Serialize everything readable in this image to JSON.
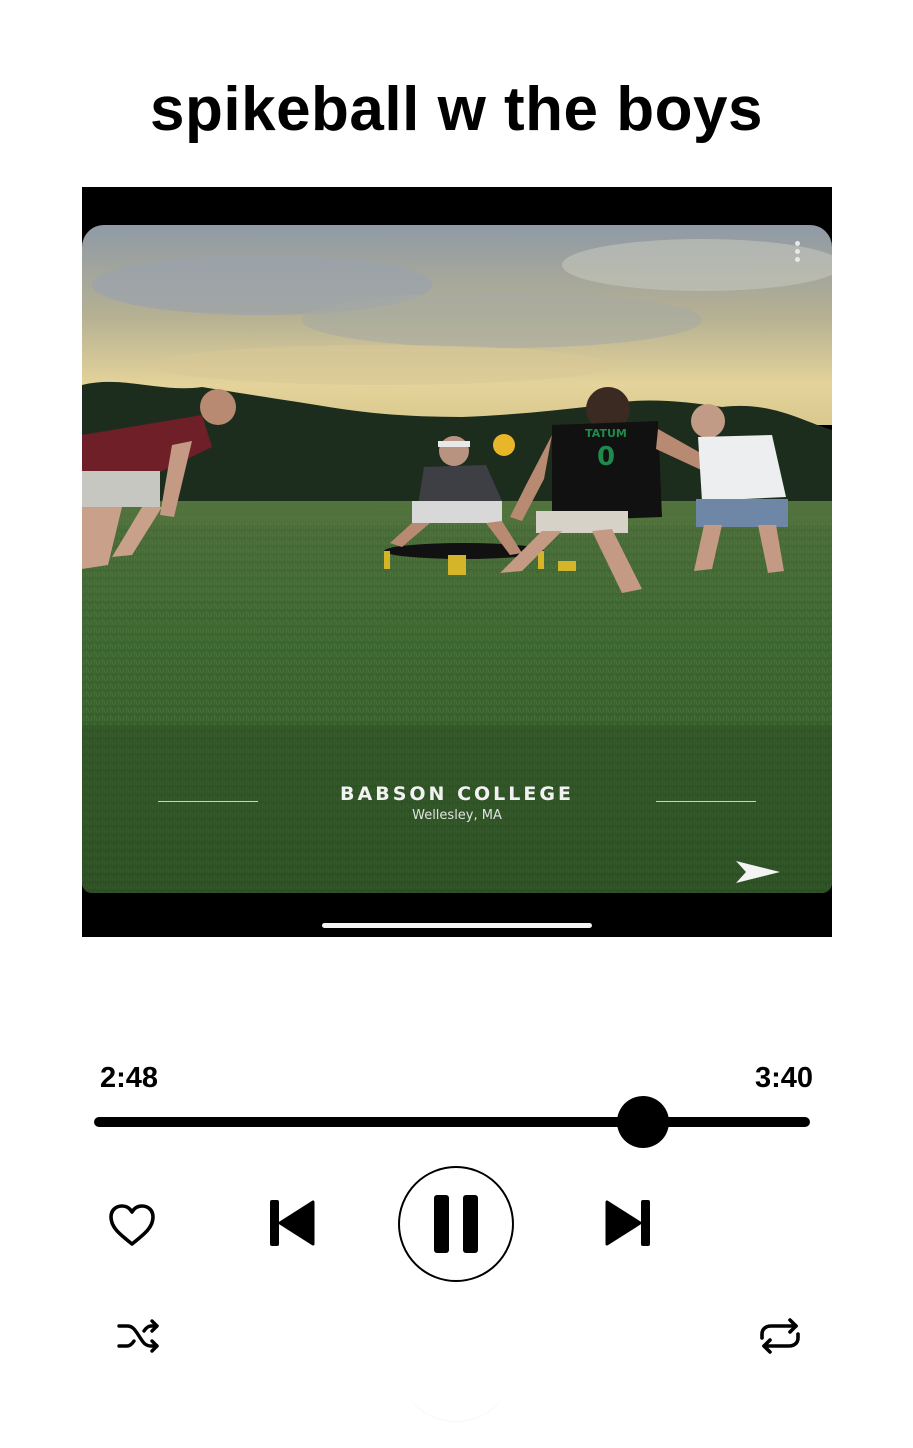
{
  "post": {
    "title": "spikeball w the boys"
  },
  "media": {
    "geofilter_title": "BABSON COLLEGE",
    "geofilter_subtitle": "Wellesley, MA",
    "jersey_text": "TATUM",
    "jersey_number": "0",
    "icons": [
      "more-vertical-icon",
      "send-arrow-icon"
    ]
  },
  "player": {
    "elapsed": "2:48",
    "total": "3:40",
    "progress_fraction": 0.767,
    "state": "playing",
    "controls": {
      "like": "heart-outline-icon",
      "previous": "skip-previous-icon",
      "pause": "pause-icon",
      "next": "skip-next-icon",
      "shuffle": "shuffle-icon",
      "repeat": "repeat-icon"
    }
  },
  "colors": {
    "background": "#ffffff",
    "controls": "#000000",
    "frame": "#000000"
  }
}
